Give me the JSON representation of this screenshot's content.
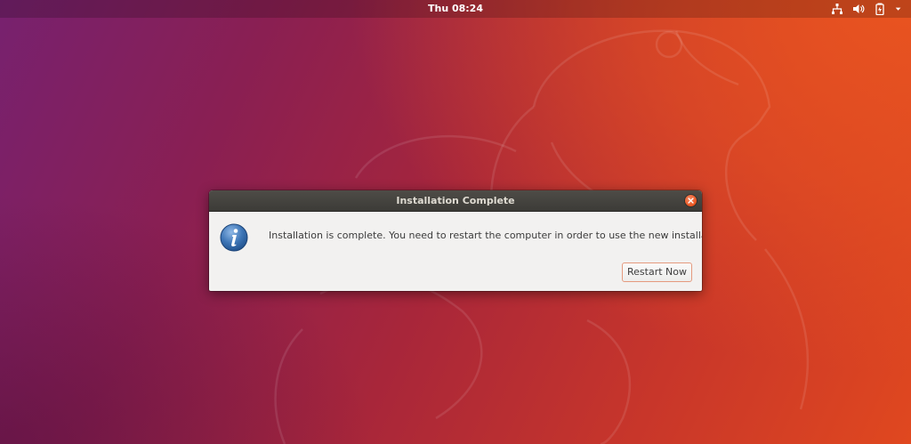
{
  "topbar": {
    "clock": "Thu 08:24",
    "icons": [
      "network-icon",
      "volume-icon",
      "battery-icon",
      "system-menu-arrow-icon"
    ]
  },
  "dialog": {
    "title": "Installation Complete",
    "message": "Installation is complete. You need to restart the computer in order to use the new installation.",
    "button_label": "Restart Now",
    "icon": "info-icon"
  },
  "colors": {
    "accent": "#e95420",
    "wallpaper_purple": "#77216f",
    "titlebar": "#3c3b37",
    "dialog_bg": "#f2f1f0"
  }
}
